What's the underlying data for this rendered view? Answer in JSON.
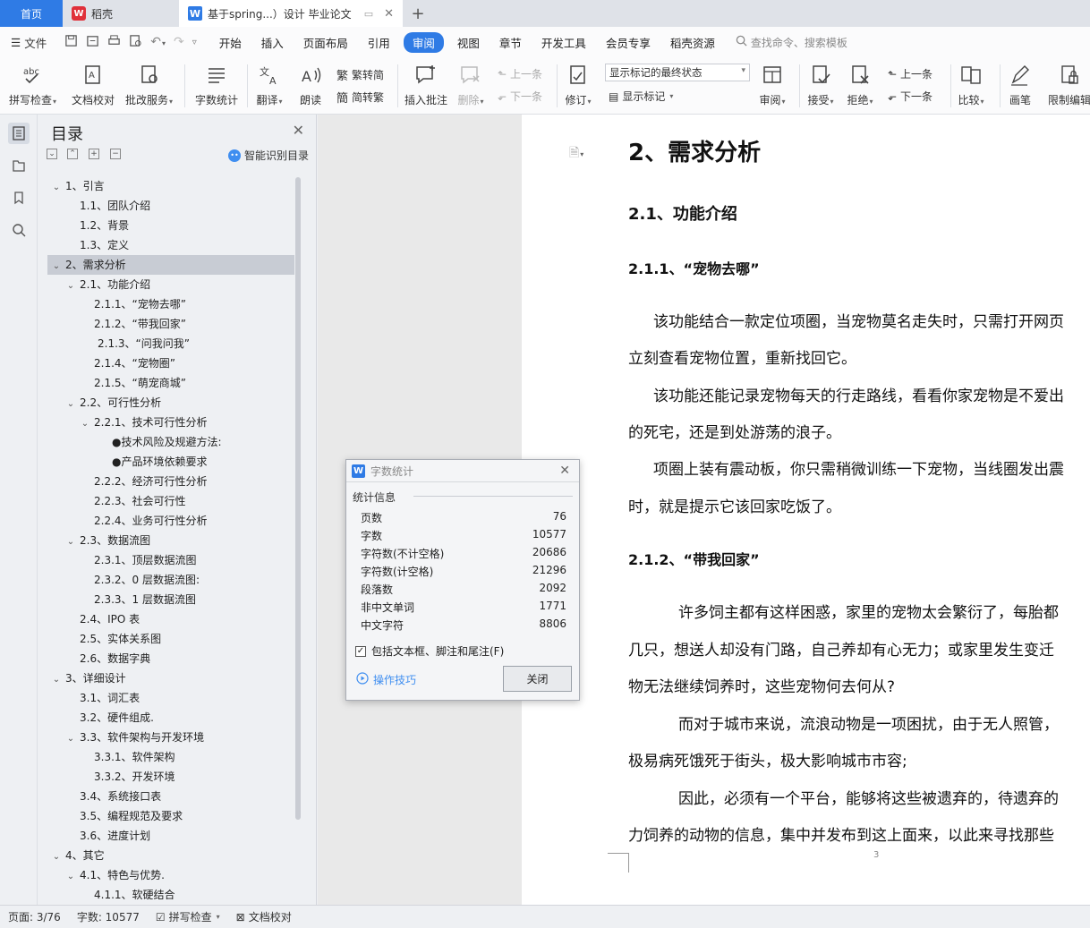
{
  "tabs": {
    "home": "首页",
    "daoke": "稻壳",
    "doc": "基于spring...）设计 毕业论文",
    "add": "+"
  },
  "menu": {
    "file": "文件",
    "items": [
      "开始",
      "插入",
      "页面布局",
      "引用",
      "审阅",
      "视图",
      "章节",
      "开发工具",
      "会员专享",
      "稻壳资源"
    ],
    "active": "审阅",
    "search": "查找命令、搜索模板"
  },
  "ribbon": {
    "spellcheck": "拼写检查",
    "doc_check": "文档校对",
    "revise_service": "批改服务",
    "word_count": "字数统计",
    "translate": "翻译",
    "read_aloud": "朗读",
    "to_traditional": "繁转简",
    "to_simplified": "简转繁",
    "insert_comment": "插入批注",
    "delete": "删除",
    "prev_comment": "上一条",
    "next_comment": "下一条",
    "track": "修订",
    "markup_select": "显示标记的最终状态",
    "show_markup": "显示标记",
    "review": "审阅",
    "accept": "接受",
    "reject": "拒绝",
    "prev_change": "上一条",
    "next_change": "下一条",
    "compare": "比较",
    "pen": "画笔",
    "restrict_edit": "限制编辑"
  },
  "nav": {
    "title": "目录",
    "smart": "智能识别目录",
    "items": [
      {
        "label": "1、引言",
        "indent": 0,
        "toggle": "v"
      },
      {
        "label": "1.1、团队介绍",
        "indent": 1,
        "toggle": ""
      },
      {
        "label": "1.2、背景",
        "indent": 1,
        "toggle": ""
      },
      {
        "label": "1.3、定义",
        "indent": 1,
        "toggle": ""
      },
      {
        "label": "2、需求分析",
        "indent": 0,
        "toggle": "v",
        "selected": true
      },
      {
        "label": "2.1、功能介绍",
        "indent": 1,
        "toggle": "v"
      },
      {
        "label": "2.1.1、“宠物去哪”",
        "indent": 2,
        "toggle": ""
      },
      {
        "label": "2.1.2、“带我回家”",
        "indent": 2,
        "toggle": ""
      },
      {
        "label": "2.1.3、“问我问我”",
        "indent": 2,
        "toggle": "",
        "nudge": true
      },
      {
        "label": "2.1.4、“宠物圈”",
        "indent": 2,
        "toggle": ""
      },
      {
        "label": "2.1.5、“萌宠商城”",
        "indent": 2,
        "toggle": ""
      },
      {
        "label": "2.2、可行性分析",
        "indent": 1,
        "toggle": "v"
      },
      {
        "label": "2.2.1、技术可行性分析",
        "indent": 2,
        "toggle": "v"
      },
      {
        "label": "●技术风险及规避方法:",
        "indent": 3,
        "toggle": ""
      },
      {
        "label": "●产品环境依赖要求",
        "indent": 3,
        "toggle": ""
      },
      {
        "label": "2.2.2、经济可行性分析",
        "indent": 2,
        "toggle": ""
      },
      {
        "label": "2.2.3、社会可行性",
        "indent": 2,
        "toggle": ""
      },
      {
        "label": "2.2.4、业务可行性分析",
        "indent": 2,
        "toggle": ""
      },
      {
        "label": "2.3、数据流图",
        "indent": 1,
        "toggle": "v"
      },
      {
        "label": "2.3.1、顶层数据流图",
        "indent": 2,
        "toggle": ""
      },
      {
        "label": "2.3.2、0 层数据流图:",
        "indent": 2,
        "toggle": ""
      },
      {
        "label": "2.3.3、1 层数据流图",
        "indent": 2,
        "toggle": ""
      },
      {
        "label": "2.4、IPO 表",
        "indent": 1,
        "toggle": ""
      },
      {
        "label": "2.5、实体关系图",
        "indent": 1,
        "toggle": ""
      },
      {
        "label": "2.6、数据字典",
        "indent": 1,
        "toggle": ""
      },
      {
        "label": "3、详细设计",
        "indent": 0,
        "toggle": "v"
      },
      {
        "label": "3.1、词汇表",
        "indent": 1,
        "toggle": ""
      },
      {
        "label": "3.2、硬件组成.",
        "indent": 1,
        "toggle": ""
      },
      {
        "label": "3.3、软件架构与开发环境",
        "indent": 1,
        "toggle": "v"
      },
      {
        "label": "3.3.1、软件架构",
        "indent": 2,
        "toggle": ""
      },
      {
        "label": "3.3.2、开发环境",
        "indent": 2,
        "toggle": ""
      },
      {
        "label": "3.4、系统接口表",
        "indent": 1,
        "toggle": ""
      },
      {
        "label": "3.5、编程规范及要求",
        "indent": 1,
        "toggle": ""
      },
      {
        "label": "3.6、进度计划",
        "indent": 1,
        "toggle": ""
      },
      {
        "label": "4、其它",
        "indent": 0,
        "toggle": "v"
      },
      {
        "label": "4.1、特色与优势.",
        "indent": 1,
        "toggle": "v"
      },
      {
        "label": "4.1.1、软硬结合",
        "indent": 2,
        "toggle": ""
      }
    ]
  },
  "document": {
    "h1": "2、需求分析",
    "h2": "2.1、功能介绍",
    "h3a": "2.1.1、“宠物去哪”",
    "para1a": "该功能结合一款定位项圈，当宠物莫名走失时，只需打开网页",
    "para1b": "立刻查看宠物位置，重新找回它。",
    "para2a": "该功能还能记录宠物每天的行走路线，看看你家宠物是不爱出",
    "para2b": "的死宅，还是到处游荡的浪子。",
    "para3a": "项圈上装有震动板，你只需稍微训练一下宠物，当线圈发出震",
    "para3b": "时，就是提示它该回家吃饭了。",
    "h3b": "2.1.2、“带我回家”",
    "para4a": "许多饲主都有这样困惑，家里的宠物太会繁衍了，每胎都",
    "para4b": "几只，想送人却没有门路，自己养却有心无力；或家里发生变迁",
    "para4c": "物无法继续饲养时，这些宠物何去何从?",
    "para5a": "而对于城市来说，流浪动物是一项困扰，由于无人照管，",
    "para5b": "极易病死饿死于街头，极大影响城市市容;",
    "para6a": "因此，必须有一个平台，能够将这些被遗弃的，待遗弃的",
    "para6b": "力饲养的动物的信息，集中并发布到这上面来，以此来寻找那些",
    "page_number": "3"
  },
  "dialog": {
    "title": "字数统计",
    "section": "统计信息",
    "rows": [
      {
        "label": "页数",
        "value": "76"
      },
      {
        "label": "字数",
        "value": "10577"
      },
      {
        "label": "字符数(不计空格)",
        "value": "20686"
      },
      {
        "label": "字符数(计空格)",
        "value": "21296"
      },
      {
        "label": "段落数",
        "value": "2092"
      },
      {
        "label": "非中文单词",
        "value": "1771"
      },
      {
        "label": "中文字符",
        "value": "8806"
      }
    ],
    "checkbox": "包括文本框、脚注和尾注(F)",
    "checked": true,
    "tips": "操作技巧",
    "close": "关闭"
  },
  "status": {
    "page": "页面: 3/76",
    "words": "字数: 10577",
    "spell": "拼写检查",
    "check": "文档校对"
  },
  "colors": {
    "accent": "#2f7be5",
    "dialog_link": "#3f8ef0"
  }
}
